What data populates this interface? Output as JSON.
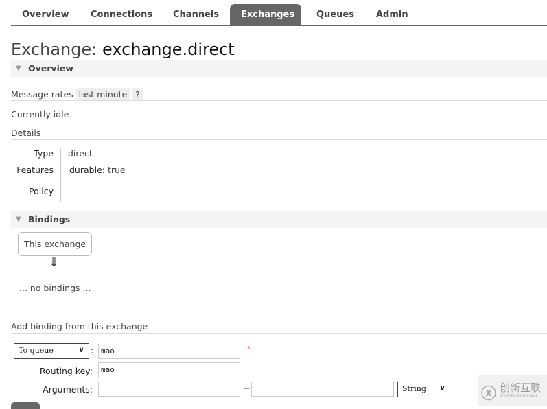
{
  "nav": {
    "tabs": [
      {
        "label": "Overview"
      },
      {
        "label": "Connections"
      },
      {
        "label": "Channels"
      },
      {
        "label": "Exchanges",
        "active": true
      },
      {
        "label": "Queues"
      },
      {
        "label": "Admin"
      }
    ]
  },
  "title": {
    "prefix": "Exchange:",
    "name": "exchange.direct"
  },
  "overview": {
    "header": "Overview",
    "message_rates_label": "Message rates",
    "rate_period": "last minute",
    "help": "?",
    "status": "Currently idle",
    "details_label": "Details",
    "details": {
      "type_label": "Type",
      "type_value": "direct",
      "features_label": "Features",
      "features_key": "durable:",
      "features_value": "true",
      "policy_label": "Policy"
    }
  },
  "bindings": {
    "header": "Bindings",
    "source_box": "This exchange",
    "arrow": "⇓",
    "empty": "... no bindings ..."
  },
  "add_binding": {
    "title": "Add binding from this exchange",
    "destination_type": "To queue",
    "colon": ":",
    "destination_value": "mao",
    "required": "*",
    "routing_key_label": "Routing key:",
    "routing_key_value": "mao",
    "arguments_label": "Arguments:",
    "arg_key": "",
    "equals": "=",
    "arg_value": "",
    "arg_type": "String"
  },
  "watermark": {
    "text": "创新互联",
    "subtext": "CHUANG XIN HU LIAN"
  },
  "colors": {
    "active_tab": "#666666",
    "section_bg": "#f4f4f4",
    "required": "#e08080"
  }
}
